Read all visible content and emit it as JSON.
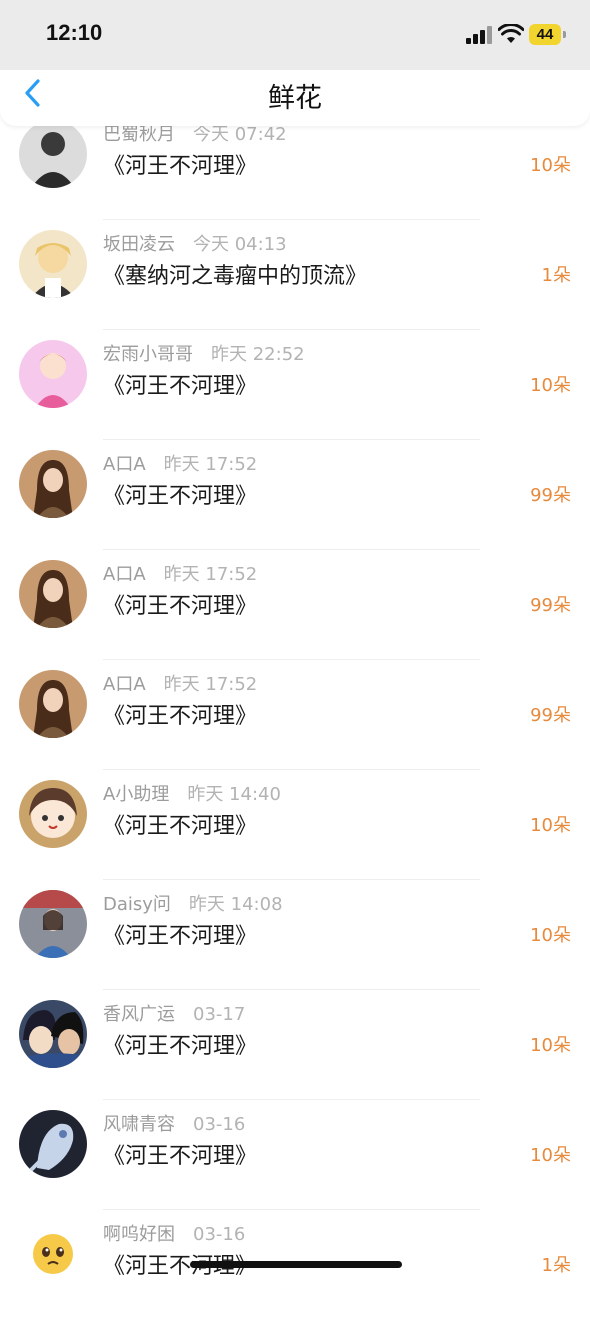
{
  "status_bar": {
    "time": "12:10",
    "battery": "44"
  },
  "header": {
    "title": "鲜花"
  },
  "rows": [
    {
      "name": "巴蜀秋月",
      "time": "今天 07:42",
      "title": "《河王不河理》",
      "count": "10朵"
    },
    {
      "name": "坂田凌云",
      "time": "今天 04:13",
      "title": "《塞纳河之毒瘤中的顶流》",
      "count": "1朵"
    },
    {
      "name": "宏雨小哥哥",
      "time": "昨天 22:52",
      "title": "《河王不河理》",
      "count": "10朵"
    },
    {
      "name": "A口A",
      "time": "昨天 17:52",
      "title": "《河王不河理》",
      "count": "99朵"
    },
    {
      "name": "A口A",
      "time": "昨天 17:52",
      "title": "《河王不河理》",
      "count": "99朵"
    },
    {
      "name": "A口A",
      "time": "昨天 17:52",
      "title": "《河王不河理》",
      "count": "99朵"
    },
    {
      "name": "A小助理",
      "time": "昨天 14:40",
      "title": "《河王不河理》",
      "count": "10朵"
    },
    {
      "name": "Daisy问",
      "time": "昨天 14:08",
      "title": "《河王不河理》",
      "count": "10朵"
    },
    {
      "name": "香风广运",
      "time": "03-17",
      "title": "《河王不河理》",
      "count": "10朵"
    },
    {
      "name": "风啸青容",
      "time": "03-16",
      "title": "《河王不河理》",
      "count": "10朵"
    },
    {
      "name": "啊呜好困",
      "time": "03-16",
      "title": "《河王不河理》",
      "count": "1朵"
    }
  ],
  "colors": {
    "accent": "#2a9df4",
    "count": "#e78a3c"
  }
}
